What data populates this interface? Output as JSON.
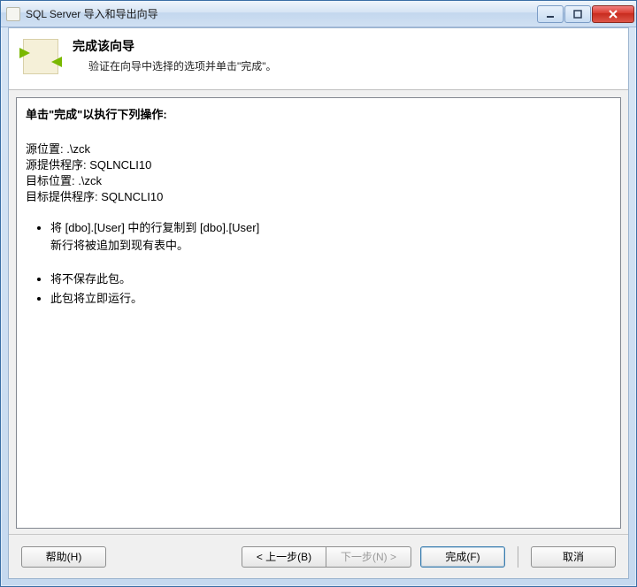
{
  "window": {
    "title": "SQL Server 导入和导出向导"
  },
  "header": {
    "title": "完成该向导",
    "subtitle": "验证在向导中选择的选项并单击\"完成\"。"
  },
  "content": {
    "heading": "单击\"完成\"以执行下列操作:",
    "source_location_label": "源位置:",
    "source_location_value": ".\\zck",
    "source_provider_label": "源提供程序:",
    "source_provider_value": "SQLNCLI10",
    "dest_location_label": "目标位置:",
    "dest_location_value": ".\\zck",
    "dest_provider_label": "目标提供程序:",
    "dest_provider_value": "SQLNCLI10",
    "bullets": {
      "b1": "将 [dbo].[User] 中的行复制到 [dbo].[User]",
      "b1sub": "新行将被追加到现有表中。",
      "b2": "将不保存此包。",
      "b3": "此包将立即运行。"
    }
  },
  "buttons": {
    "help": "帮助(H)",
    "back": "< 上一步(B)",
    "next": "下一步(N) >",
    "finish": "完成(F)",
    "cancel": "取消"
  }
}
